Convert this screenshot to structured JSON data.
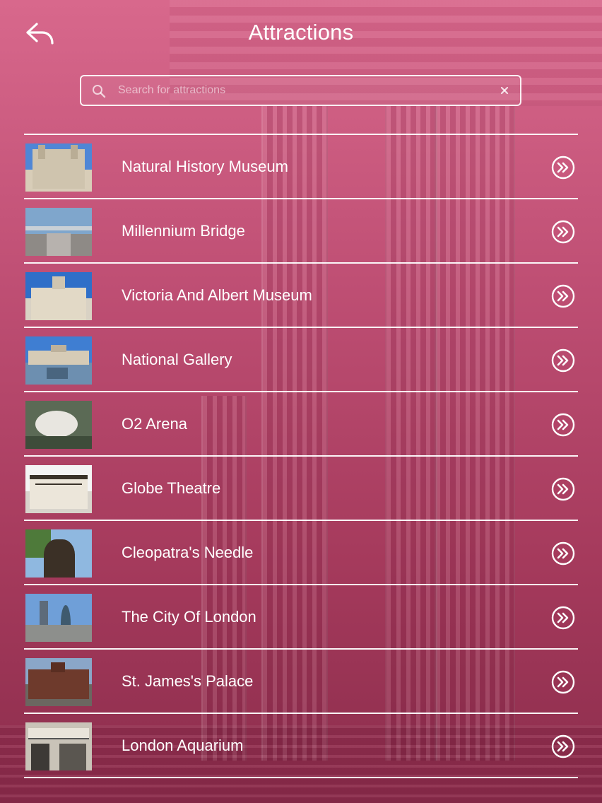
{
  "header": {
    "title": "Attractions",
    "back_icon": "back-arrow-icon"
  },
  "search": {
    "placeholder": "Search for attractions",
    "value": "",
    "search_icon": "search-icon",
    "clear_icon": "clear-icon"
  },
  "colors": {
    "background_top": "#d8688c",
    "background_bottom": "#8c2d4c",
    "text": "#ffffff",
    "divider": "#ffffff"
  },
  "attractions": [
    {
      "label": "Natural History Museum",
      "icon": "chevron-double-right-icon"
    },
    {
      "label": "Millennium Bridge",
      "icon": "chevron-double-right-icon"
    },
    {
      "label": "Victoria And Albert Museum",
      "icon": "chevron-double-right-icon"
    },
    {
      "label": "National Gallery",
      "icon": "chevron-double-right-icon"
    },
    {
      "label": "O2 Arena",
      "icon": "chevron-double-right-icon"
    },
    {
      "label": "Globe Theatre",
      "icon": "chevron-double-right-icon"
    },
    {
      "label": "Cleopatra's Needle",
      "icon": "chevron-double-right-icon"
    },
    {
      "label": "The City Of London",
      "icon": "chevron-double-right-icon"
    },
    {
      "label": "St. James's Palace",
      "icon": "chevron-double-right-icon"
    },
    {
      "label": "London Aquarium",
      "icon": "chevron-double-right-icon"
    }
  ]
}
